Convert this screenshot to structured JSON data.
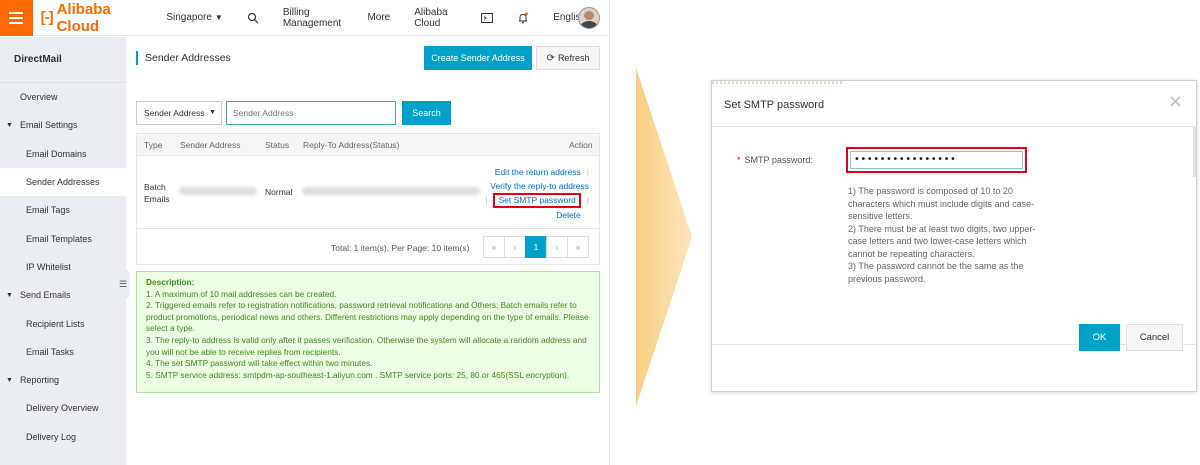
{
  "topbar": {
    "logo_text": "Alibaba Cloud",
    "region": "Singapore",
    "nav": [
      "Billing Management",
      "More",
      "Alibaba Cloud",
      "English"
    ]
  },
  "sidebar": {
    "title": "DirectMail",
    "items": [
      {
        "label": "Overview",
        "kind": "l1"
      },
      {
        "label": "Email Settings",
        "kind": "group"
      },
      {
        "label": "Email Domains",
        "kind": "l2"
      },
      {
        "label": "Sender Addresses",
        "kind": "l2",
        "active": true
      },
      {
        "label": "Email Tags",
        "kind": "l2"
      },
      {
        "label": "Email Templates",
        "kind": "l2"
      },
      {
        "label": "IP Whitelist",
        "kind": "l2"
      },
      {
        "label": "Send Emails",
        "kind": "group"
      },
      {
        "label": "Recipient Lists",
        "kind": "l2"
      },
      {
        "label": "Email Tasks",
        "kind": "l2"
      },
      {
        "label": "Reporting",
        "kind": "group"
      },
      {
        "label": "Delivery Overview",
        "kind": "l2"
      },
      {
        "label": "Delivery Log",
        "kind": "l2"
      }
    ]
  },
  "page": {
    "title": "Sender Addresses",
    "create_button": "Create Sender Address",
    "refresh_button": "Refresh"
  },
  "search": {
    "select_value": "Sender Address",
    "placeholder": "Sender Address",
    "button": "Search"
  },
  "table": {
    "headers": {
      "type": "Type",
      "sender": "Sender Address",
      "status": "Status",
      "reply": "Reply-To Address(Status)",
      "action": "Action"
    },
    "row": {
      "type": "Batch Emails",
      "status": "Normal",
      "actions": {
        "edit": "Edit the return address",
        "verify": "Verify the reply-to address",
        "smtp": "Set SMTP password",
        "delete": "Delete"
      }
    },
    "total": "Total: 1 item(s), Per Page: 10 item(s)",
    "pager": {
      "first": "«",
      "prev": "‹",
      "current": "1",
      "next": "›",
      "last": "»"
    }
  },
  "description": {
    "heading": "Description:",
    "lines": [
      "1. A maximum of 10 mail addresses can be created.",
      "2. Triggered emails refer to registration notifications, password retrieval notifications and Others; Batch emails refer to product promotions, periodical news and others. Different restrictions may apply depending on the type of emails. Please select a type.",
      "3. The reply-to address is valid only after it passes verification. Otherwise the system will allocate a random address and you will not be able to receive replies from recipients.",
      "4. The set SMTP password will take effect within two minutes.",
      "5. SMTP service address: smtpdm-ap-southeast-1.aliyun.com . SMTP service ports: 25, 80 or 465(SSL encryption)."
    ]
  },
  "dialog": {
    "title": "Set SMTP password",
    "field_label": "SMTP password:",
    "required_mark": "*",
    "password_value": "••••••••••••••••",
    "rules": [
      "1) The password is composed of 10 to 20 characters which must include digits and case-sensitive letters.",
      "2) There must be at least two digits, two upper-case letters and two lower-case letters which cannot be repeating characters.",
      "3) The password cannot be the same as the previous password."
    ],
    "ok": "OK",
    "cancel": "Cancel"
  },
  "colors": {
    "brand": "#ff6a00",
    "primary": "#00a2ca",
    "highlight": "#e60012",
    "description_bg": "#eefee4"
  }
}
